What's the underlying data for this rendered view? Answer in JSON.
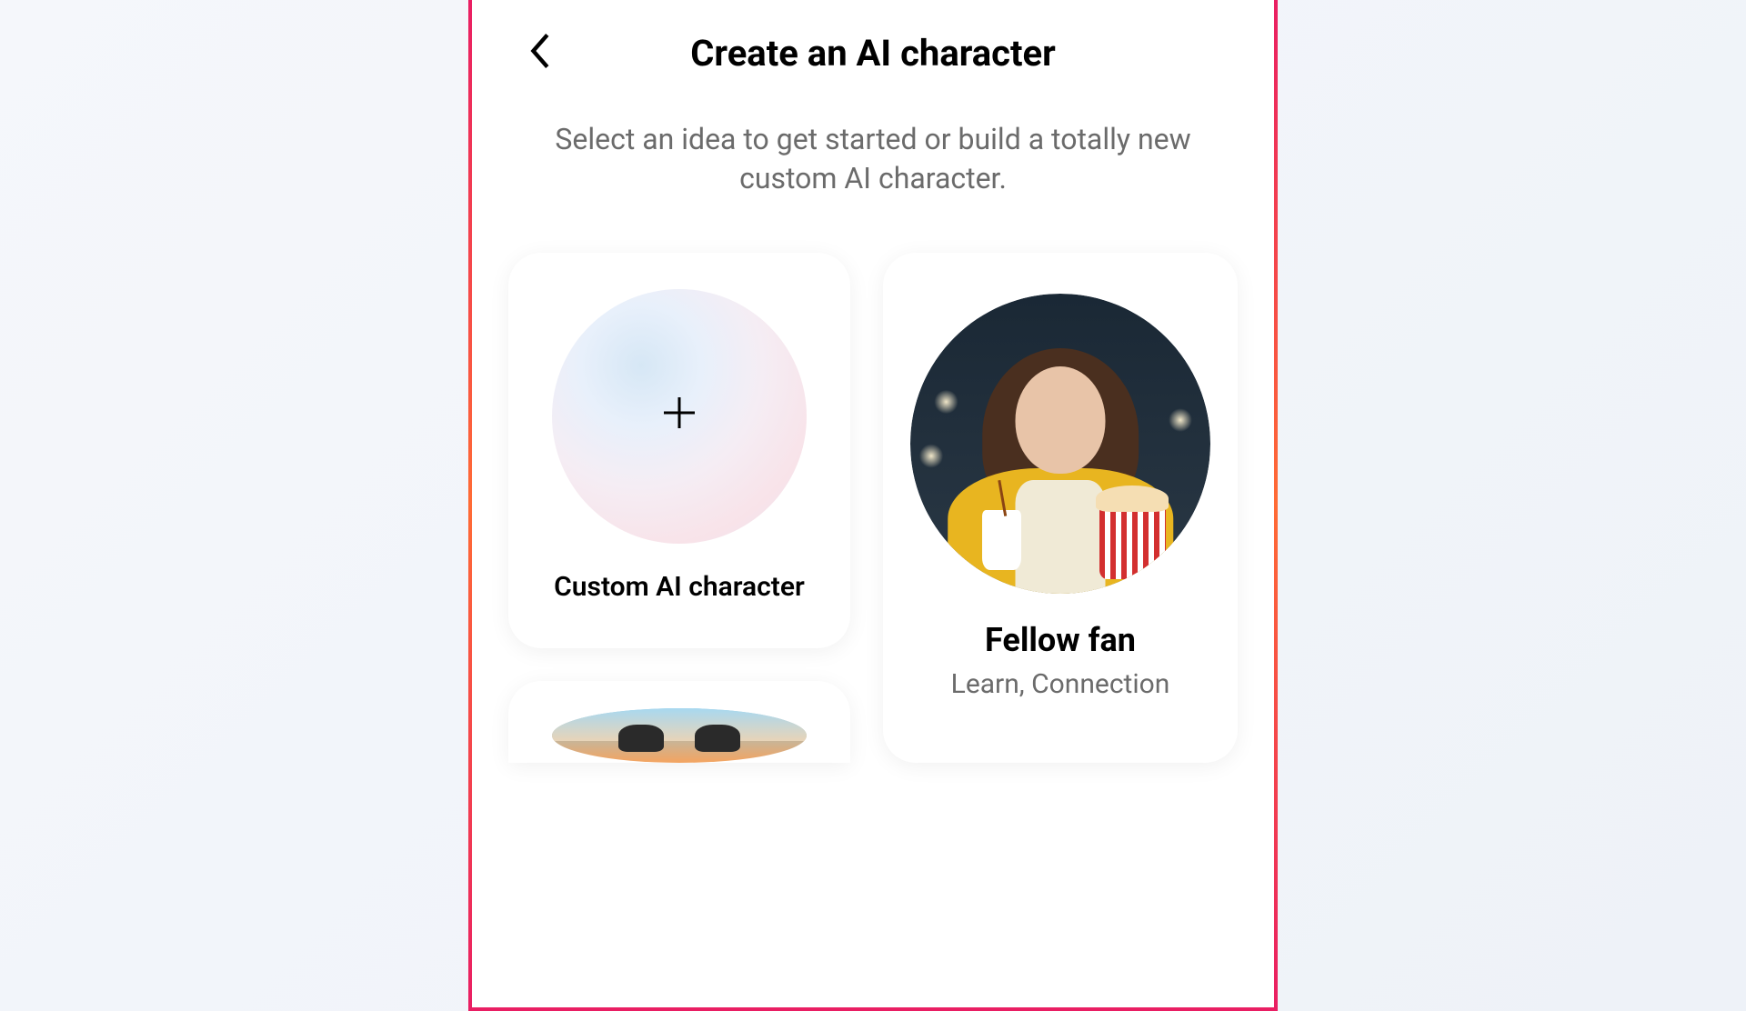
{
  "header": {
    "title": "Create an AI character"
  },
  "subtitle": "Select an idea to get started or build a totally new custom AI character.",
  "cards": {
    "custom": {
      "title": "Custom AI character"
    },
    "fellow_fan": {
      "title": "Fellow fan",
      "subtitle": "Learn, Connection"
    }
  }
}
